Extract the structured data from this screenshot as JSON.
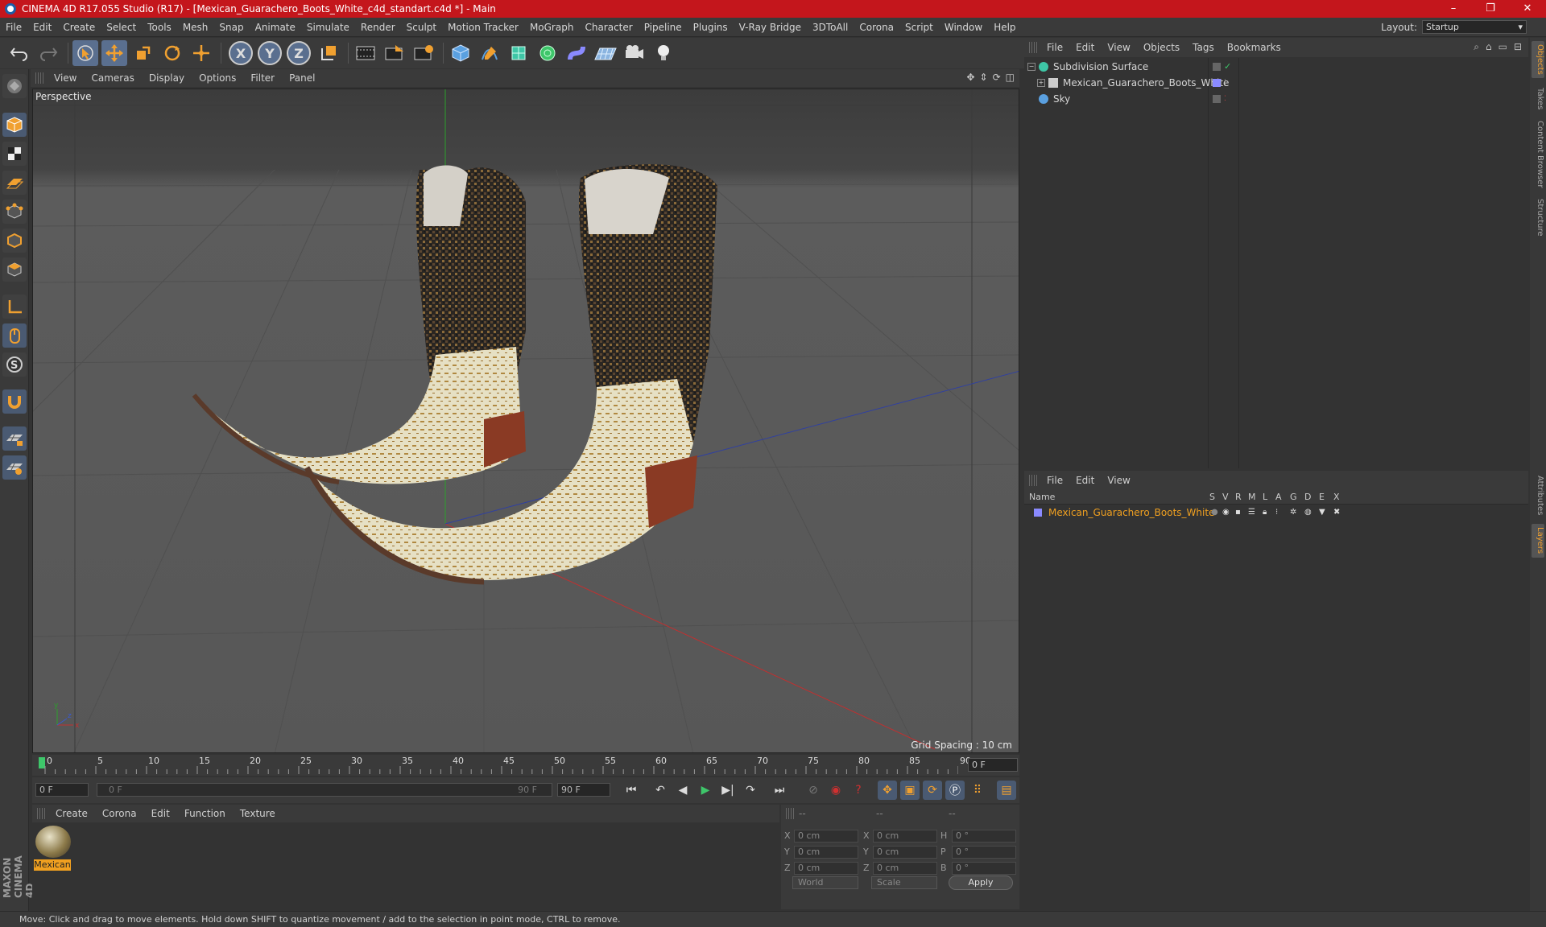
{
  "window": {
    "title": "CINEMA 4D R17.055 Studio (R17) - [Mexican_Guarachero_Boots_White_c4d_standart.c4d *] - Main",
    "controls": [
      "–",
      "❐",
      "✕"
    ]
  },
  "menubar": {
    "items": [
      "File",
      "Edit",
      "Create",
      "Select",
      "Tools",
      "Mesh",
      "Snap",
      "Animate",
      "Simulate",
      "Render",
      "Sculpt",
      "Motion Tracker",
      "MoGraph",
      "Character",
      "Pipeline",
      "Plugins",
      "V-Ray Bridge",
      "3DToAll",
      "Corona",
      "Script",
      "Window",
      "Help"
    ],
    "layout_label": "Layout:",
    "layout_value": "Startup"
  },
  "toolbar": {
    "axis_x": "X",
    "axis_y": "Y",
    "axis_z": "Z"
  },
  "viewport": {
    "menu": [
      "View",
      "Cameras",
      "Display",
      "Options",
      "Filter",
      "Panel"
    ],
    "label": "Perspective",
    "grid_spacing": "Grid Spacing : 10 cm"
  },
  "timeline": {
    "ticks": [
      "0",
      "5",
      "10",
      "15",
      "20",
      "25",
      "30",
      "35",
      "40",
      "45",
      "50",
      "55",
      "60",
      "65",
      "70",
      "75",
      "80",
      "85",
      "90"
    ],
    "frame_end_display": "0 F"
  },
  "transport": {
    "start_field": "0 F",
    "slider_start": "0 F",
    "slider_end": "90 F",
    "end_field": "90 F"
  },
  "material_manager": {
    "menu": [
      "Create",
      "Corona",
      "Edit",
      "Function",
      "Texture"
    ],
    "materials": [
      {
        "name": "Mexican"
      }
    ]
  },
  "coordinates": {
    "header": [
      "--",
      "--",
      "--"
    ],
    "rows": [
      {
        "pos_label": "X",
        "pos": "0 cm",
        "size_label": "X",
        "size": "0 cm",
        "rot_label": "H",
        "rot": "0 °"
      },
      {
        "pos_label": "Y",
        "pos": "0 cm",
        "size_label": "Y",
        "size": "0 cm",
        "rot_label": "P",
        "rot": "0 °"
      },
      {
        "pos_label": "Z",
        "pos": "0 cm",
        "size_label": "Z",
        "size": "0 cm",
        "rot_label": "B",
        "rot": "0 °"
      }
    ],
    "mode_world": "World",
    "mode_scale": "Scale",
    "apply_label": "Apply"
  },
  "object_manager": {
    "menu": [
      "File",
      "Edit",
      "View",
      "Objects",
      "Tags",
      "Bookmarks"
    ],
    "objects": [
      {
        "name": "Subdivision Surface",
        "icon_color": "#3ec6a6"
      },
      {
        "name": "Mexican_Guarachero_Boots_White",
        "icon_color": "#cccccc"
      },
      {
        "name": "Sky",
        "icon_color": "#5aa0e0"
      }
    ]
  },
  "layer_manager": {
    "menu": [
      "File",
      "Edit",
      "View"
    ],
    "columns": [
      "Name",
      "S",
      "V",
      "R",
      "M",
      "L",
      "A",
      "G",
      "D",
      "E",
      "X"
    ],
    "layers": [
      {
        "name": "Mexican_Guarachero_Boots_White",
        "color": "#f0a020"
      }
    ]
  },
  "right_tabs": [
    "Objects",
    "Takes",
    "Content Browser",
    "Structure",
    "Attributes",
    "Layers"
  ],
  "brand": "MAXON CINEMA 4D",
  "statusbar": {
    "text": "Move: Click and drag to move elements. Hold down SHIFT to quantize movement / add to the selection in point mode, CTRL to remove."
  },
  "colors": {
    "accent": "#f0a020",
    "titlebar": "#c4161c",
    "selection": "#5a6f8f"
  }
}
